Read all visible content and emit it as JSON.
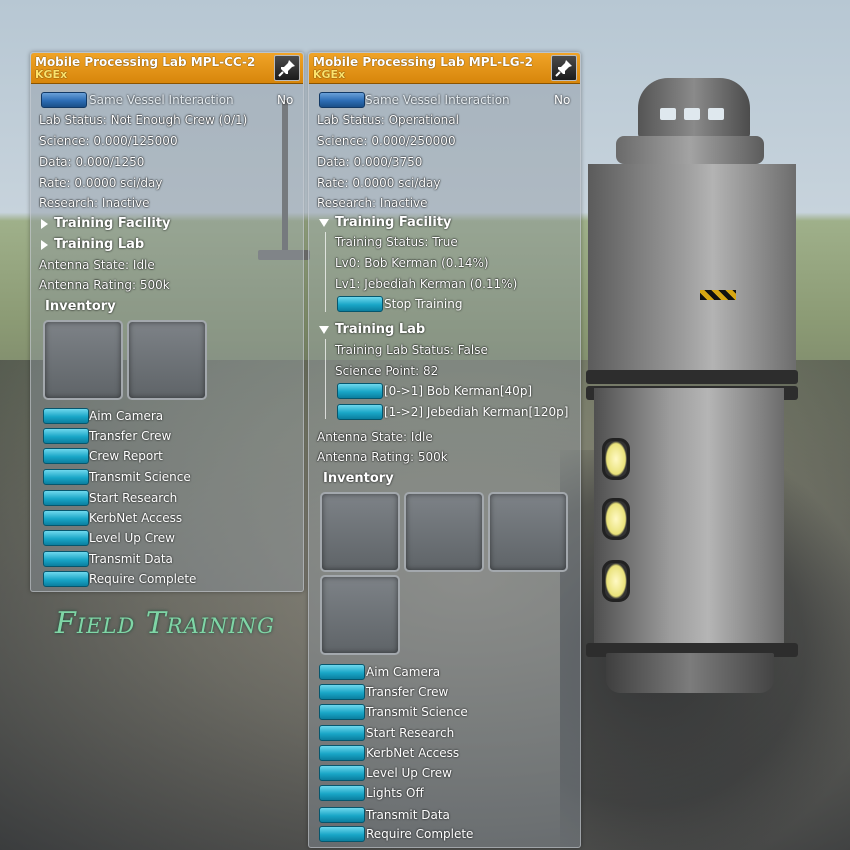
{
  "scene": {
    "overlay_title": "Field Training",
    "overlay_color": "#7fd6a6"
  },
  "window_left": {
    "title": "Mobile Processing Lab MPL-CC-2",
    "subtitle": "KGEx",
    "pin_icon": "pin-icon",
    "same_vessel_label": "Same Vessel Interaction",
    "same_vessel_value": "No",
    "lab_status": "Lab Status: Not Enough Crew (0/1)",
    "science": "Science: 0.000/125000",
    "data": "Data: 0.000/1250",
    "rate": "Rate: 0.0000 sci/day",
    "research": "Research: Inactive",
    "training_facility": "Training Facility",
    "training_lab": "Training Lab",
    "antenna_state": "Antenna State: Idle",
    "antenna_rating": "Antenna Rating: 500k",
    "inventory": "Inventory",
    "actions": [
      "Aim Camera",
      "Transfer Crew",
      "Crew Report",
      "Transmit Science",
      "Start Research",
      "KerbNet Access",
      "Level Up Crew",
      "Transmit Data",
      "Require Complete"
    ]
  },
  "window_right": {
    "title": "Mobile Processing Lab MPL-LG-2",
    "subtitle": "KGEx",
    "pin_icon": "pin-icon",
    "same_vessel_label": "Same Vessel Interaction",
    "same_vessel_value": "No",
    "lab_status": "Lab Status: Operational",
    "science": "Science: 0.000/250000",
    "data": "Data: 0.000/3750",
    "rate": "Rate: 0.0000 sci/day",
    "research": "Research: Inactive",
    "training_facility": "Training Facility",
    "training_status": "Training Status: True",
    "lv0": "Lv0: Bob Kerman (0.14%)",
    "lv1": "Lv1: Jebediah Kerman (0.11%)",
    "stop_training": "Stop Training",
    "training_lab": "Training Lab",
    "training_lab_status": "Training Lab Status: False",
    "science_point": "Science Point: 82",
    "upgrade_1": "[0->1] Bob Kerman[40p]",
    "upgrade_2": "[1->2] Jebediah Kerman[120p]",
    "antenna_state": "Antenna State: Idle",
    "antenna_rating": "Antenna Rating: 500k",
    "inventory": "Inventory",
    "actions": [
      "Aim Camera",
      "Transfer Crew",
      "Transmit Science",
      "Start Research",
      "KerbNet Access",
      "Level Up Crew",
      "Lights Off",
      "Transmit Data",
      "Require Complete"
    ]
  },
  "colors": {
    "titlebar": "#e8970f",
    "subtitle": "#fde36b",
    "action_button": "#19a6c7",
    "toggle_button": "#2c6db5"
  }
}
